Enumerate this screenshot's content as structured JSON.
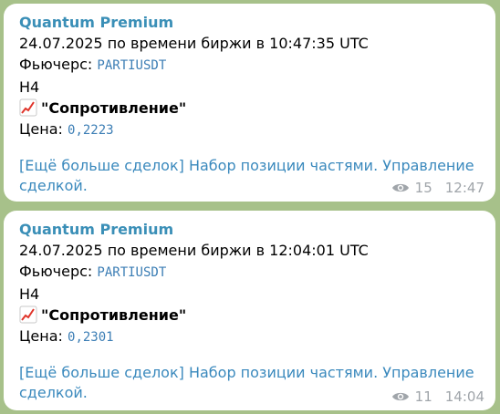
{
  "messages": [
    {
      "sender": "Quantum Premium",
      "datetime": "24.07.2025 по времени биржи в 10:47:35 UTC",
      "futures_label": "Фьючерс:",
      "futures_value": "PARTIUSDT",
      "timeframe": "H4",
      "signal_icon": "chart-increasing-icon",
      "signal": "\"Сопротивление\"",
      "price_label": "Цена:",
      "price_value": "0,2223",
      "link_text": "[Ещё больше сделок] Набор позиции частями. Управление сделкой.",
      "link_line1": "[Ещё больше сделок] Набор позиции частями. Управление",
      "link_line2": "сделкой.",
      "views": "15",
      "time": "12:47"
    },
    {
      "sender": "Quantum Premium",
      "datetime": "24.07.2025 по времени биржи в 12:04:01 UTC",
      "futures_label": "Фьючерс:",
      "futures_value": "PARTIUSDT",
      "timeframe": "H4",
      "signal_icon": "chart-increasing-icon",
      "signal": "\"Сопротивление\"",
      "price_label": "Цена:",
      "price_value": "0,2301",
      "link_text": "[Ещё больше сделок] Набор позиции частями. Управление сделкой.",
      "link_line1": "[Ещё больше сделок] Набор позиции частями. Управление",
      "link_line2": "сделкой.",
      "views": "11",
      "time": "14:04"
    }
  ],
  "colors": {
    "background": "#a7c18a",
    "bubble": "#ffffff",
    "sender": "#3a8fb7",
    "link": "#3a89bd",
    "meta": "#a0a5aa"
  }
}
